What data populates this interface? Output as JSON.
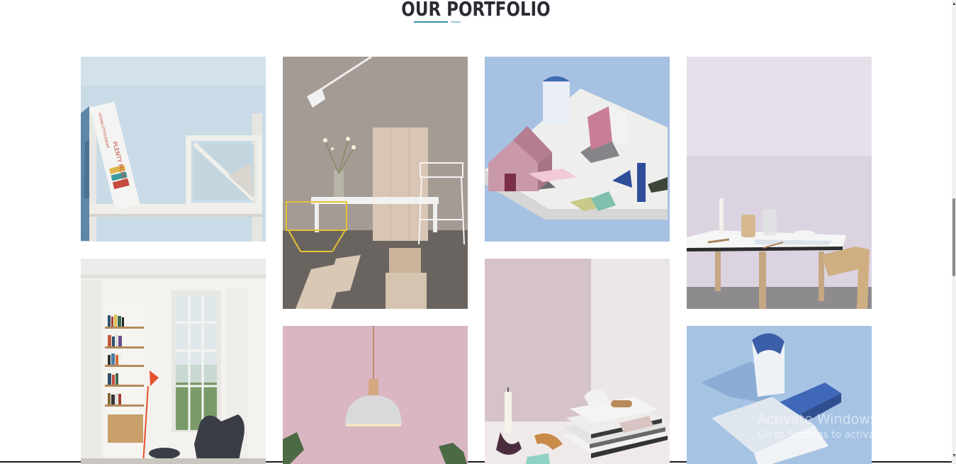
{
  "section": {
    "title": "OUR PORTFOLIO"
  },
  "portfolio": {
    "items": [
      {
        "name": "white-shelf-book"
      },
      {
        "name": "lamp-bench-room"
      },
      {
        "name": "paper-house-model"
      },
      {
        "name": "table-lilac-wall"
      },
      {
        "name": "bookshelf-living-room"
      },
      {
        "name": "pendant-lamp-pink"
      },
      {
        "name": "candle-books-corner"
      },
      {
        "name": "blue-paper-bag"
      }
    ]
  },
  "book": {
    "author": "YOTAM OTTOLENGHI",
    "title": "PLENTY MORE"
  },
  "watermark": {
    "title": "Activate Windows",
    "subtitle": "Go to Settings to activate Windows."
  }
}
